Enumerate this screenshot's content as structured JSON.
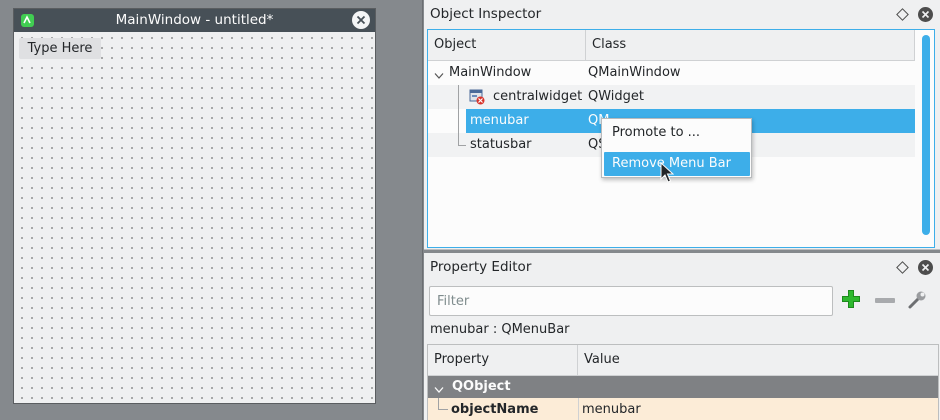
{
  "main_window": {
    "title": "MainWindow - untitled*",
    "menu_placeholder": "Type Here"
  },
  "object_inspector": {
    "title": "Object Inspector",
    "columns": [
      "Object",
      "Class"
    ],
    "rows": [
      {
        "object": "MainWindow",
        "class": "QMainWindow"
      },
      {
        "object": "centralwidget",
        "class": "QWidget"
      },
      {
        "object": "menubar",
        "class": "QM"
      },
      {
        "object": "statusbar",
        "class": "QS"
      }
    ],
    "selected_row": "menubar"
  },
  "context_menu": {
    "items": [
      "Promote to ...",
      "Remove Menu Bar"
    ],
    "highlighted": "Remove Menu Bar"
  },
  "property_editor": {
    "title": "Property Editor",
    "filter_placeholder": "Filter",
    "object_label": "menubar : QMenuBar",
    "columns": [
      "Property",
      "Value"
    ],
    "group": "QObject",
    "property": {
      "name": "objectName",
      "value": "menubar"
    }
  },
  "colors": {
    "accent": "#3daee9",
    "titlebar": "#475057",
    "add_icon": "#2eb82e",
    "highlight_row": "#fcecd7"
  },
  "icons": [
    "app-icon",
    "close-icon",
    "expand-arrow-icon",
    "widget-icon",
    "float-icon",
    "add-icon",
    "remove-icon",
    "configure-icon",
    "mouse-cursor-icon"
  ]
}
